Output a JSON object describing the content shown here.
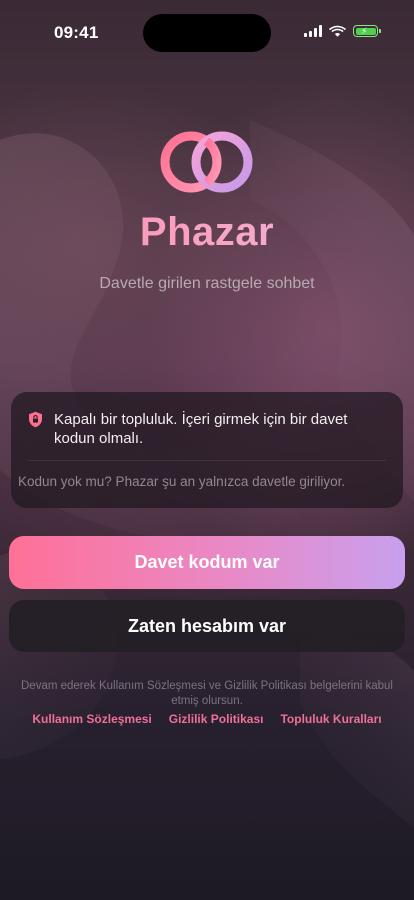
{
  "status_bar": {
    "time": "09:41"
  },
  "app": {
    "name": "Phazar",
    "tagline": "Davetle girilen rastgele sohbet",
    "colors": {
      "accent_pink": "#ff7097",
      "accent_lilac": "#c8a0ee",
      "link": "#ee6f97"
    }
  },
  "info_card": {
    "icon": "shield-icon",
    "message": "Kapalı bir topluluk. İçeri girmek için bir davet kodun olmalı.",
    "subtext": "Kodun yok mu? Phazar şu an yalnızca davetle giriliyor."
  },
  "actions": {
    "primary_label": "Davet kodum var",
    "secondary_label": "Zaten hesabım var"
  },
  "legal": {
    "text": "Devam ederek Kullanım Sözleşmesi ve Gizlilik Politikası belgelerini kabul etmiş olursun.",
    "links": [
      "Kullanım Sözleşmesi",
      "Gizlilik Politikası",
      "Topluluk Kuralları"
    ]
  }
}
